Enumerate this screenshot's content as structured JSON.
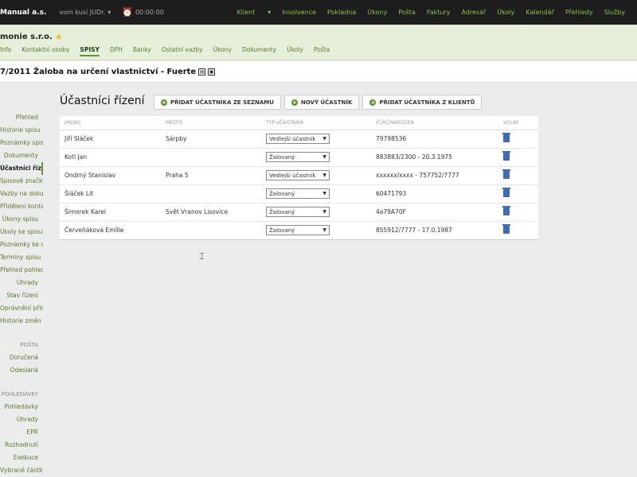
{
  "topbar": {
    "brand": "Manual a.s.",
    "user": "vom kusí JUDr.",
    "timer": "00:00:00",
    "nav": [
      "Klient",
      "Insolvence",
      "Pokladna",
      "Úkony",
      "Pošta",
      "Faktury",
      "Adresář",
      "Úkoly",
      "Kalendář",
      "Přehledy",
      "Služby"
    ]
  },
  "header": {
    "company": "monie s.r.o.",
    "subnav": [
      "Info",
      "Kontaktní osoby",
      "SPISY",
      "DPH",
      "Banky",
      "Ostatní vazby",
      "Úkony",
      "Dokumenty",
      "Úkoly",
      "Pošta"
    ],
    "active_subnav": "SPISY"
  },
  "case": {
    "title": "7/2011 Žaloba na určení vlastnictví - Fuerte"
  },
  "sidebar": {
    "items": [
      "Přehled",
      "Historie spisu",
      "Poznámky spisu",
      "Dokumenty",
      "Účastníci řízení",
      "Spisové značky",
      "Vazby na dokumenty",
      "Přidělení kontakty",
      "Úkony spisu",
      "Úkoly ke spisu",
      "Poznámky ke spisu",
      "Termíny spisu",
      "Přehled pohledávky",
      "Úhrady",
      "Stav řízení",
      "Oprávnění přístupu",
      "Historie změn"
    ],
    "active": "Účastníci řízení",
    "section1": "POŠTA",
    "section1_items": [
      "Doručená",
      "Odeslaná"
    ],
    "section2": "POHLEDÁVKY",
    "section2_items": [
      "Pohledávky",
      "Úhrady",
      "EPR",
      "Rozhodnutí",
      "Exekuce",
      "Vybrané částky"
    ]
  },
  "main": {
    "title": "Účastníci řízení",
    "buttons": [
      "PŘIDAT ÚČASTNÍKA ZE SEZNAMU",
      "NOVÝ ÚČASTNÍK",
      "PŘIDAT ÚČASTNÍKA Z KLIENTŮ"
    ],
    "columns": [
      "JMÉNO",
      "MĚSTO",
      "TYP ÚČASTNÍKA",
      "IČ/RČ/NAROZEN",
      "VOLBY"
    ],
    "rows": [
      {
        "name": "Jiří Sláček",
        "city": "Sárpby",
        "type": "Vedlejší účastník",
        "id": "79798536"
      },
      {
        "name": "Kotl Jan",
        "city": "",
        "type": "Žalovaný",
        "id": "883883/2300 - 20.3.1975"
      },
      {
        "name": "Ondrný Stanislav",
        "city": "Praha 5",
        "type": "Vedlejší účastník",
        "id": "xxxxxx/xxxx - 757752/7777"
      },
      {
        "name": "Šláček Lit",
        "city": "",
        "type": "Žalovaný",
        "id": "60471793"
      },
      {
        "name": "Šimorek Karel",
        "city": "Svět Vranov Lisovice",
        "type": "Žalovaný",
        "id": "4a79A70F"
      },
      {
        "name": "Červeňáková Emílie",
        "city": "",
        "type": "Žalovaný",
        "id": "855912/7777 - 17.0.1987"
      }
    ]
  }
}
